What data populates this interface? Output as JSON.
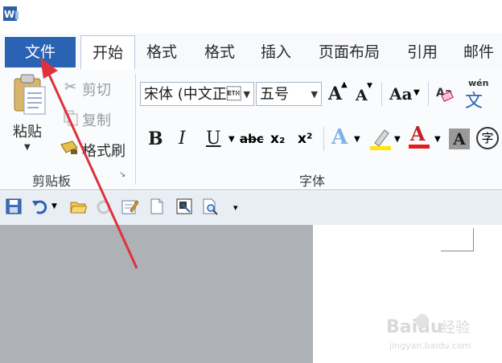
{
  "app": {
    "logo_letter": "W"
  },
  "tabs": [
    {
      "label": "文件"
    },
    {
      "label": "开始"
    },
    {
      "label": "格式"
    },
    {
      "label": "格式"
    },
    {
      "label": "插入"
    },
    {
      "label": "页面布局"
    },
    {
      "label": "引用"
    },
    {
      "label": "邮件"
    }
  ],
  "clipboard": {
    "paste_label": "粘贴",
    "cut_label": "剪切",
    "copy_label": "复制",
    "format_painter_label": "格式刷",
    "group_label": "剪贴板"
  },
  "font": {
    "font_name": "宋体 (中文正\u0003",
    "font_size": "五号",
    "grow_label": "A",
    "shrink_label": "A",
    "case_label": "Aa",
    "bold": "B",
    "italic": "I",
    "underline": "U",
    "strike": "abc",
    "subscript": "x₂",
    "superscript": "x²",
    "text_effect": "A",
    "font_color": "A",
    "shade": "A",
    "enclose": "字",
    "wen_label": "wén",
    "wen_char": "文",
    "group_label": "字体"
  },
  "watermark": {
    "brand": "Baidu",
    "sub": "经验",
    "url": "jingyan.baidu.com"
  },
  "colors": {
    "file_tab": "#2a63b3",
    "highlight": "#ffe800",
    "font_color_bar": "#e31b1b",
    "arrow": "#e0303a"
  }
}
